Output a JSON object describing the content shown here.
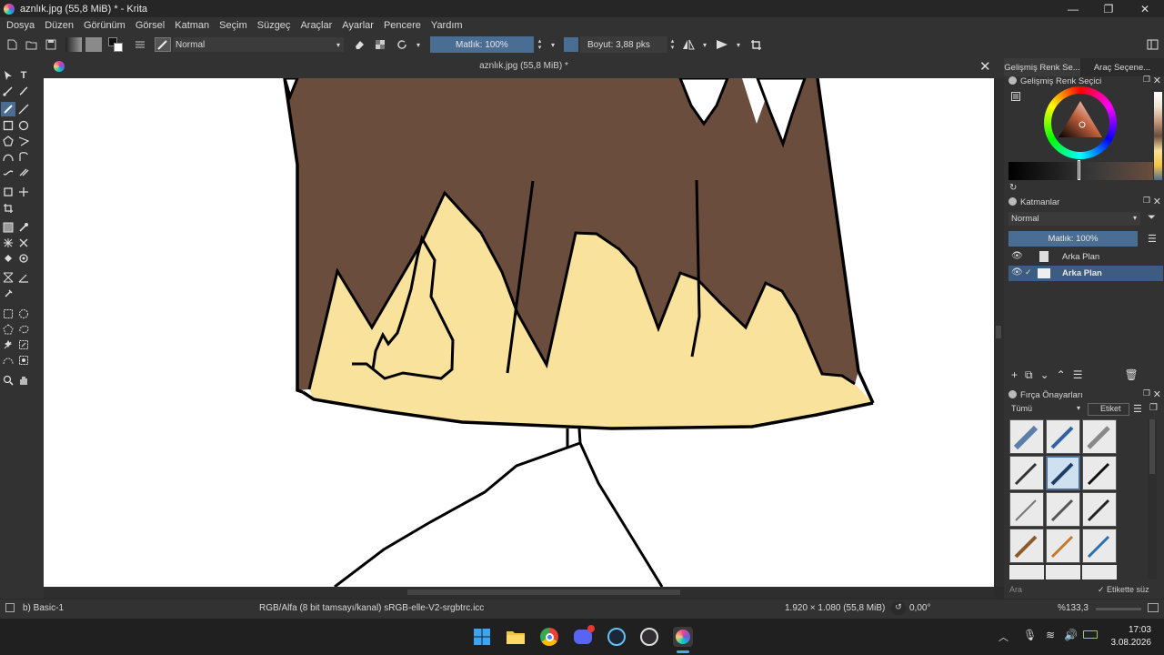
{
  "window": {
    "title": "aznlık.jpg (55,8 MiB) * - Krita",
    "controls": [
      "—",
      "❐",
      "✕"
    ]
  },
  "menu": [
    "Dosya",
    "Düzen",
    "Görünüm",
    "Görsel",
    "Katman",
    "Seçim",
    "Süzgeç",
    "Araçlar",
    "Ayarlar",
    "Pencere",
    "Yardım"
  ],
  "toolbar": {
    "blend_mode": "Normal",
    "opacity_label": "Matlık: 100%",
    "opacity_value": 1.0,
    "size_label": "Boyut: 3,88 pks"
  },
  "document": {
    "tab_title": "aznlık.jpg (55,8 MiB) *"
  },
  "dockers": {
    "tabs": [
      "Gelişmiş Renk Se...",
      "Araç Seçene..."
    ],
    "color_selector_title": "Gelişmiş Renk Seçici",
    "layers_title": "Katmanlar",
    "layer_blend": "Normal",
    "layer_opacity_label": "Matlık:  100%",
    "layers": [
      {
        "name": "Arka Plan",
        "selected": false
      },
      {
        "name": "Arka Plan",
        "selected": true
      }
    ],
    "brush_presets_title": "Fırça Önayarları",
    "preset_filter": "Tümü",
    "tag_label": "Etiket",
    "search_placeholder": "Ara",
    "filter_checkbox_label": "Etikette süz"
  },
  "status": {
    "brush": "b) Basic-1",
    "color_profile": "RGB/Alfa (8 bit tamsayı/kanal) sRGB-elle-V2-srgbtrc.icc",
    "dimensions": "1.920 × 1.080 (55,8 MiB)",
    "rotation": "0,00°",
    "zoom": "%133,3"
  },
  "taskbar": {
    "apps": [
      "windows-start",
      "file-explorer",
      "chrome",
      "discord",
      "steam",
      "obs",
      "krita"
    ],
    "time": "17:03",
    "date": "3.08.2026"
  },
  "colors": {
    "hair_brown": "#6b4d3e",
    "skin_yellow": "#f9e29c",
    "accent_blue": "#4a6d94",
    "selected_row": "#3d5c82"
  }
}
